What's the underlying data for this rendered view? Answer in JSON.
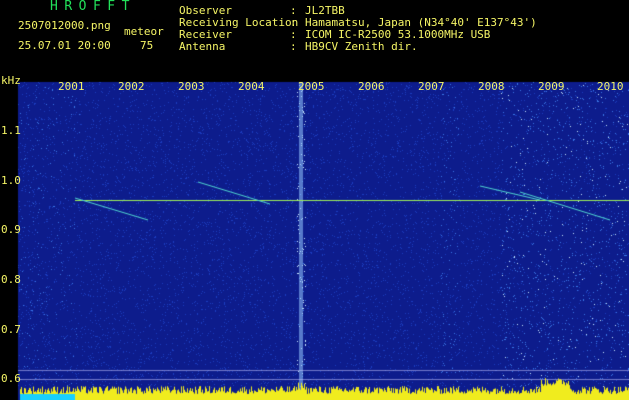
{
  "header": {
    "app_title": "HROFFT",
    "filename": "2507012000.png",
    "datetime": "25.07.01 20:00",
    "meteor_label": "meteor",
    "meteor_count": "75",
    "info": [
      {
        "label": "Observer",
        "value": "JL2TBB"
      },
      {
        "label": "Receiving Location",
        "value": "Hamamatsu, Japan (N34°40' E137°43')"
      },
      {
        "label": "Receiver",
        "value": "ICOM IC-R2500 53.1000MHz USB"
      },
      {
        "label": "Antenna",
        "value": "HB9CV Zenith dir."
      }
    ],
    "separator": ":"
  },
  "axis": {
    "y_unit": "kHz",
    "x_ticks": [
      "2001",
      "2002",
      "2003",
      "2004",
      "2005",
      "2006",
      "2007",
      "2008",
      "2009",
      "2010"
    ],
    "y_ticks": [
      "1.1",
      "1.0",
      "0.9",
      "0.8",
      "0.7",
      "0.6"
    ]
  },
  "colors": {
    "background": "#000000",
    "text": "#f5f566",
    "title": "#22e05a",
    "spectrum": "#0d1c8c",
    "carrier": "#9ff05a",
    "level": "#f0ec1e",
    "level_peak": "#18d0ff"
  }
}
